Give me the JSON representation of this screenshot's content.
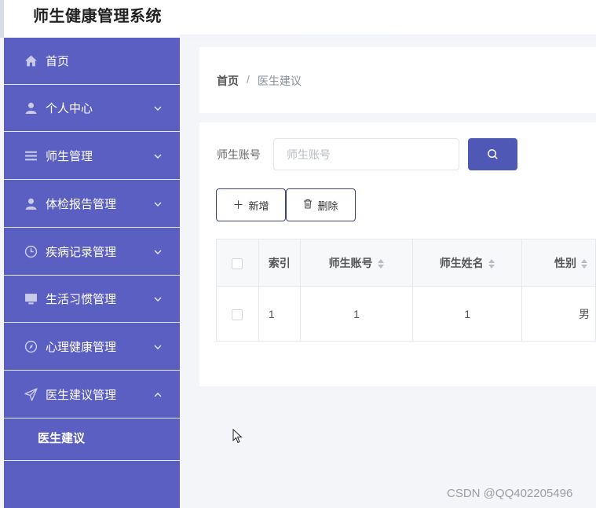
{
  "app": {
    "title": "师生健康管理系统"
  },
  "sidebar": {
    "items": [
      {
        "label": "首页",
        "icon": "home-icon",
        "has_chevron": false
      },
      {
        "label": "个人中心",
        "icon": "user-icon",
        "has_chevron": true
      },
      {
        "label": "师生管理",
        "icon": "list-icon",
        "has_chevron": true
      },
      {
        "label": "体检报告管理",
        "icon": "user-icon",
        "has_chevron": true
      },
      {
        "label": "疾病记录管理",
        "icon": "clock-icon",
        "has_chevron": true
      },
      {
        "label": "生活习惯管理",
        "icon": "monitor-icon",
        "has_chevron": true
      },
      {
        "label": "心理健康管理",
        "icon": "compass-icon",
        "has_chevron": true
      },
      {
        "label": "医生建议管理",
        "icon": "send-icon",
        "has_chevron": true,
        "expanded": true
      }
    ],
    "sub_items": [
      {
        "label": "医生建议"
      }
    ]
  },
  "breadcrumb": {
    "home": "首页",
    "separator": "/",
    "current": "医生建议"
  },
  "search": {
    "label": "师生账号",
    "placeholder": "师生账号",
    "value": ""
  },
  "toolbar": {
    "add_label": "新增",
    "delete_label": "删除"
  },
  "table": {
    "columns": [
      "索引",
      "师生账号",
      "师生姓名",
      "性别"
    ],
    "rows": [
      [
        "1",
        "1",
        "1",
        "男"
      ]
    ]
  },
  "watermark": "CSDN @QQ402205496",
  "colors": {
    "sidebar": "#5b5fc2",
    "primary_button": "#4f58b4",
    "background": "#f4f5f8"
  }
}
